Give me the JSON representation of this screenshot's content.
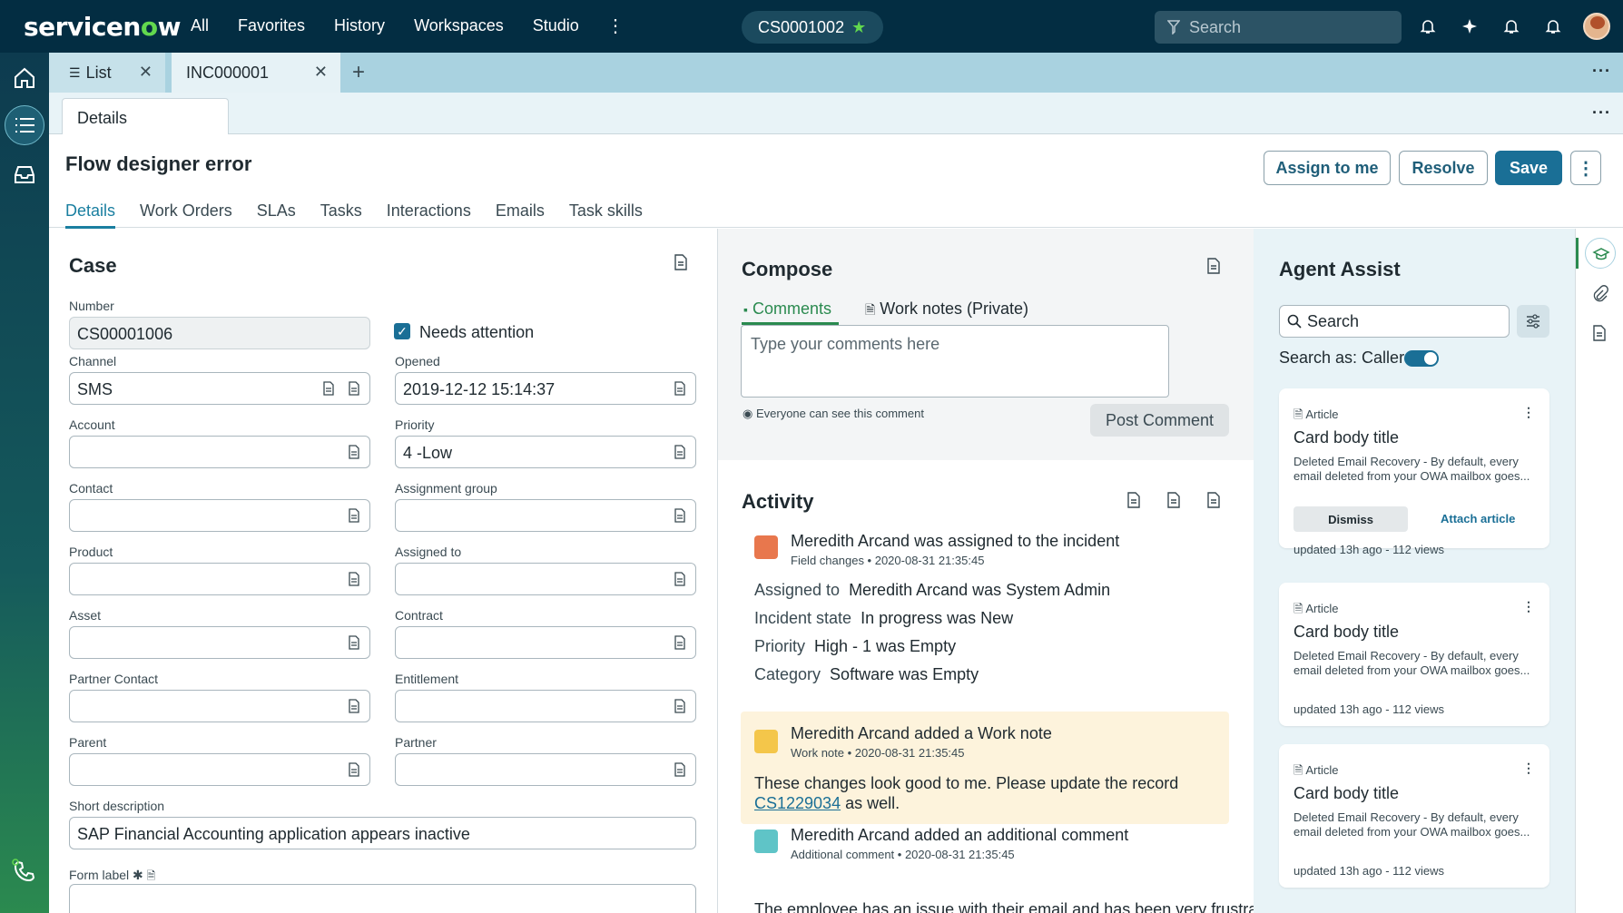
{
  "topbar": {
    "logo": "servicenow",
    "nav": [
      "All",
      "Favorites",
      "History",
      "Workspaces",
      "Studio"
    ],
    "case_pill": "CS0001002",
    "search_placeholder": "Search",
    "icons": [
      "bell-icon",
      "sparkle-icon",
      "bell-icon",
      "bell-icon"
    ]
  },
  "tabs": {
    "list": "List",
    "record": "INC000001",
    "details": "Details"
  },
  "record": {
    "title": "Flow designer error",
    "buttons": {
      "assign": "Assign to me",
      "resolve": "Resolve",
      "save": "Save"
    },
    "tabs": [
      "Details",
      "Work Orders",
      "SLAs",
      "Tasks",
      "Interactions",
      "Emails",
      "Task skills"
    ]
  },
  "case": {
    "heading": "Case",
    "number_label": "Number",
    "number": "CS00001006",
    "needs_attention": "Needs attention",
    "channel_label": "Channel",
    "channel": "SMS",
    "opened_label": "Opened",
    "opened": "2019-12-12 15:14:37",
    "account_label": "Account",
    "priority_label": "Priority",
    "priority": "4 -Low",
    "contact_label": "Contact",
    "assignment_group_label": "Assignment group",
    "product_label": "Product",
    "assigned_to_label": "Assigned to",
    "asset_label": "Asset",
    "contract_label": "Contract",
    "partner_contact_label": "Partner Contact",
    "entitlement_label": "Entitlement",
    "parent_label": "Parent",
    "partner_label": "Partner",
    "short_desc_label": "Short description",
    "short_desc": "SAP Financial Accounting application appears inactive",
    "form_label": "Form label"
  },
  "compose": {
    "heading": "Compose",
    "tab_comments": "Comments",
    "tab_worknotes": "Work notes (Private)",
    "placeholder": "Type your comments here",
    "visibility": "Everyone can see this comment",
    "post": "Post Comment"
  },
  "activity": {
    "heading": "Activity",
    "items": [
      {
        "title": "Meredith Arcand was assigned to the incident",
        "meta": "Field changes  •  2020-08-31 21:35:45",
        "color": "#e8774d",
        "changes": [
          {
            "k": "Assigned to",
            "v": "Meredith Arcand was System Admin"
          },
          {
            "k": "Incident state",
            "v": "In progress was New"
          },
          {
            "k": "Priority",
            "v": "High - 1 was Empty"
          },
          {
            "k": "Category",
            "v": "Software was Empty"
          }
        ]
      },
      {
        "title": "Meredith Arcand added a Work note",
        "meta": "Work note  •  2020-08-31 21:35:45",
        "color": "#f4c64a",
        "body": "These changes look good to me. Please update the record",
        "link": "CS1229034",
        "tail": "as well."
      },
      {
        "title": "Meredith Arcand added an additional comment",
        "meta": "Additional comment  •  2020-08-31 21:35:45",
        "color": "#5fc4c7",
        "body": "The employee has an issue with their email and has been very frustrated"
      }
    ]
  },
  "agent": {
    "heading": "Agent Assist",
    "search": "Search",
    "search_as": "Search as: Caller",
    "cards": [
      {
        "type": "Article",
        "title": "Card body title",
        "body": "Deleted Email Recovery - By default, every email deleted from your OWA mailbox goes...",
        "meta": "updated 13h ago - 112 views",
        "dismiss": "Dismiss",
        "attach": "Attach article"
      },
      {
        "type": "Article",
        "title": "Card body title",
        "body": "Deleted Email Recovery - By default, every email deleted from your OWA mailbox goes...",
        "meta": "updated 13h ago - 112 views"
      },
      {
        "type": "Article",
        "title": "Card body title",
        "body": "Deleted Email Recovery - By default, every email deleted from your OWA mailbox goes...",
        "meta": "updated 13h ago - 112 views"
      }
    ]
  },
  "colors": {
    "brand_dark": "#032d42",
    "accent_green": "#62d84e",
    "primary": "#1a6f96"
  }
}
